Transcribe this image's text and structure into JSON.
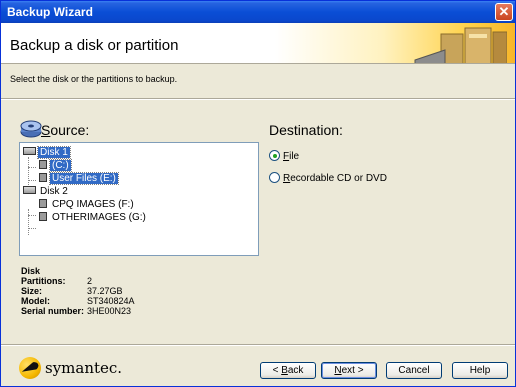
{
  "window": {
    "title": "Backup Wizard",
    "close_glyph": "✕"
  },
  "header": {
    "title": "Backup a disk or partition"
  },
  "instructions": "Select the disk or the partitions to backup.",
  "source": {
    "label_accel": "S",
    "label_rest": "ource:",
    "icon": "source-disk-icon"
  },
  "destination": {
    "label": "Destination:",
    "options": [
      {
        "accel": "F",
        "rest": "ile",
        "checked": true
      },
      {
        "accel": "R",
        "rest": "ecordable CD or DVD",
        "checked": false
      }
    ]
  },
  "tree": {
    "disks": [
      {
        "label": "Disk 1",
        "selected": true,
        "partitions": [
          {
            "label": "(C:)",
            "selected": true
          },
          {
            "label": "User Files (E:)",
            "selected": true
          }
        ]
      },
      {
        "label": "Disk 2",
        "selected": false,
        "partitions": [
          {
            "label": "CPQ IMAGES (F:)",
            "selected": false
          },
          {
            "label": "OTHERIMAGES (G:)",
            "selected": false
          }
        ]
      }
    ]
  },
  "disk_info": {
    "heading": "Disk",
    "rows": [
      {
        "key": "Partitions:",
        "value": "2"
      },
      {
        "key": "Size:",
        "value": "37.27GB"
      },
      {
        "key": "Model:",
        "value": "ST340824A"
      },
      {
        "key": "Serial number:",
        "value": "3HE00N23"
      }
    ]
  },
  "footer": {
    "brand": "symantec.",
    "buttons": {
      "back": {
        "pre": "< ",
        "accel": "B",
        "rest": "ack"
      },
      "next": {
        "accel": "N",
        "rest": "ext >"
      },
      "cancel": "Cancel",
      "help": "Help"
    }
  },
  "colors": {
    "title_bar": "#0a4ed6",
    "selection": "#316ac5",
    "header_accent": "#f7b529"
  }
}
